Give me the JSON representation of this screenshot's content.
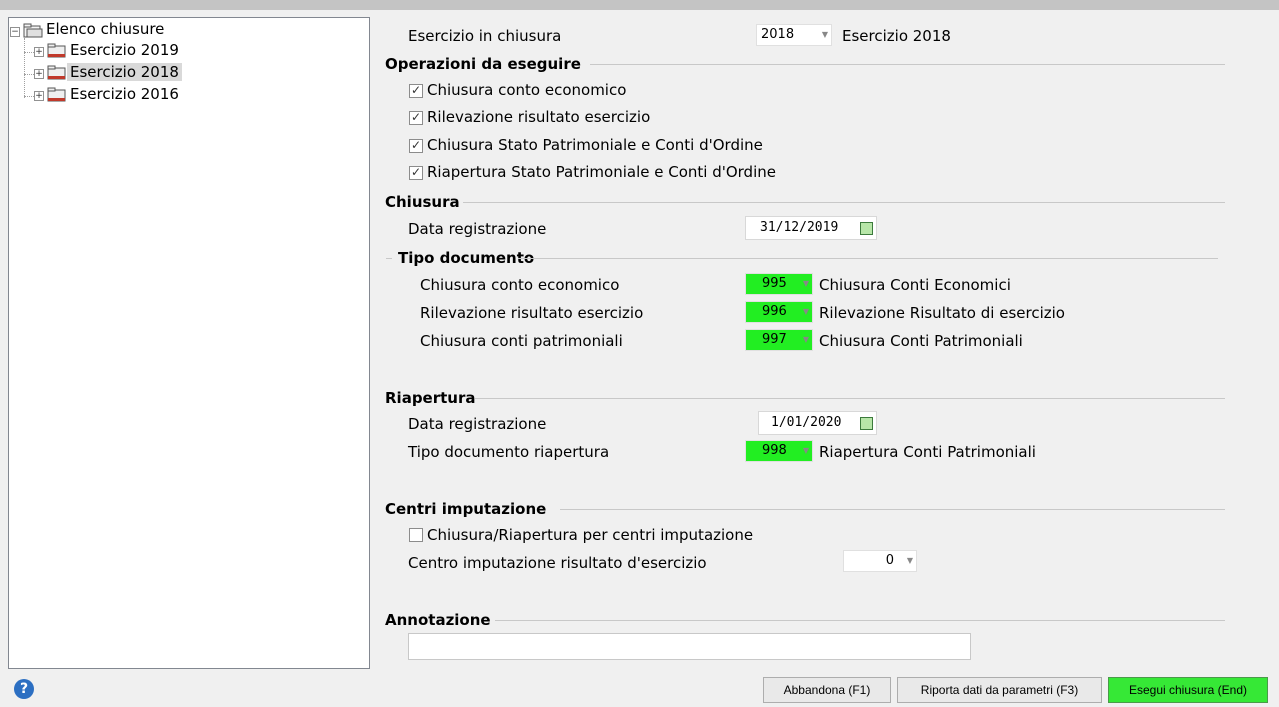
{
  "tree": {
    "root": {
      "label": "Elenco chiusure"
    },
    "items": [
      {
        "label": "Esercizio 2019"
      },
      {
        "label": "Esercizio 2018"
      },
      {
        "label": "Esercizio 2016"
      }
    ]
  },
  "header": {
    "esercizio_label": "Esercizio in chiusura",
    "esercizio_value": "2018",
    "esercizio_desc": "Esercizio 2018"
  },
  "operazioni": {
    "title": "Operazioni da eseguire",
    "items": [
      {
        "label": "Chiusura conto economico",
        "checked": true
      },
      {
        "label": "Rilevazione risultato esercizio",
        "checked": true
      },
      {
        "label": "Chiusura Stato Patrimoniale e Conti d'Ordine",
        "checked": true
      },
      {
        "label": "Riapertura Stato Patrimoniale e Conti d'Ordine",
        "checked": true
      }
    ]
  },
  "chiusura": {
    "title": "Chiusura",
    "data_label": "Data registrazione",
    "data_value": "31/12/2019",
    "tipo_title": "Tipo documento",
    "rows": [
      {
        "label": "Chiusura conto economico",
        "code": "995",
        "desc": "Chiusura Conti Economici"
      },
      {
        "label": "Rilevazione risultato esercizio",
        "code": "996",
        "desc": "Rilevazione Risultato di esercizio"
      },
      {
        "label": "Chiusura conti patrimoniali",
        "code": "997",
        "desc": "Chiusura Conti Patrimoniali"
      }
    ]
  },
  "riapertura": {
    "title": "Riapertura",
    "data_label": "Data registrazione",
    "data_value": "1/01/2020",
    "tipo_label": "Tipo documento riapertura",
    "tipo_code": "998",
    "tipo_desc": "Riapertura Conti Patrimoniali"
  },
  "centri": {
    "title": "Centri imputazione",
    "checkbox_label": "Chiusura/Riapertura per centri imputazione",
    "checkbox_checked": false,
    "centro_label": "Centro imputazione risultato d'esercizio",
    "centro_value": "0"
  },
  "annotazione": {
    "title": "Annotazione",
    "value": ""
  },
  "buttons": {
    "abbandona": "Abbandona (F1)",
    "riporta": "Riporta dati da parametri (F3)",
    "esegui": "Esegui chiusura (End)"
  },
  "glyphs": {
    "check": "✓",
    "arrow": "▼",
    "minus": "−",
    "plus": "+",
    "help": "?"
  },
  "colors": {
    "highlight": "#22ee22",
    "primary_button": "#36e836"
  }
}
